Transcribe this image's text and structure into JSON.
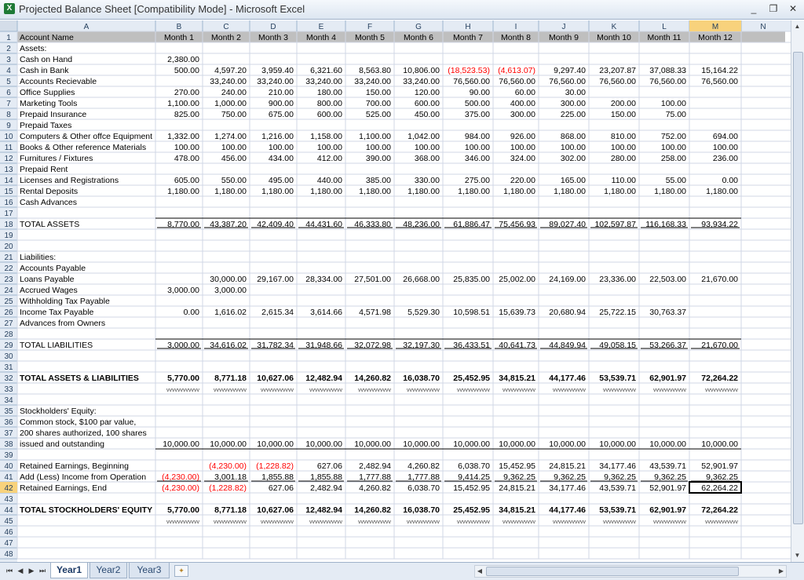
{
  "window": {
    "title": "Projected Balance Sheet  [Compatibility Mode] - Microsoft Excel",
    "icon": "excel-icon",
    "controls": [
      "_",
      "❐",
      "✕"
    ]
  },
  "grid": {
    "columns": [
      "A",
      "B",
      "C",
      "D",
      "E",
      "F",
      "G",
      "H",
      "I",
      "J",
      "K",
      "L",
      "M",
      "N"
    ],
    "selected_column": "M",
    "selected_row": 42,
    "row_count": 48,
    "rows": [
      [
        "Account Name",
        "Month 1",
        "Month 2",
        "Month 3",
        "Month 4",
        "Month 5",
        "Month 6",
        "Month 7",
        "Month 8",
        "Month 9",
        "Month 10",
        "Month 11",
        "Month 12"
      ],
      [
        "Assets:"
      ],
      [
        "Cash on Hand",
        "2,380.00"
      ],
      [
        "Cash in Bank",
        "500.00",
        "4,597.20",
        "3,959.40",
        "6,321.60",
        "8,563.80",
        "10,806.00",
        "(18,523.53)",
        "(4,613.07)",
        "9,297.40",
        "23,207.87",
        "37,088.33",
        "15,164.22"
      ],
      [
        "Accounts Recievable",
        "",
        "33,240.00",
        "33,240.00",
        "33,240.00",
        "33,240.00",
        "33,240.00",
        "76,560.00",
        "76,560.00",
        "76,560.00",
        "76,560.00",
        "76,560.00",
        "76,560.00"
      ],
      [
        "Office Supplies",
        "270.00",
        "240.00",
        "210.00",
        "180.00",
        "150.00",
        "120.00",
        "90.00",
        "60.00",
        "30.00"
      ],
      [
        "Marketing Tools",
        "1,100.00",
        "1,000.00",
        "900.00",
        "800.00",
        "700.00",
        "600.00",
        "500.00",
        "400.00",
        "300.00",
        "200.00",
        "100.00"
      ],
      [
        "Prepaid Insurance",
        "825.00",
        "750.00",
        "675.00",
        "600.00",
        "525.00",
        "450.00",
        "375.00",
        "300.00",
        "225.00",
        "150.00",
        "75.00"
      ],
      [
        "Prepaid Taxes"
      ],
      [
        "Computers & Other offce Equipment",
        "1,332.00",
        "1,274.00",
        "1,216.00",
        "1,158.00",
        "1,100.00",
        "1,042.00",
        "984.00",
        "926.00",
        "868.00",
        "810.00",
        "752.00",
        "694.00"
      ],
      [
        "Books & Other reference Materials",
        "100.00",
        "100.00",
        "100.00",
        "100.00",
        "100.00",
        "100.00",
        "100.00",
        "100.00",
        "100.00",
        "100.00",
        "100.00",
        "100.00"
      ],
      [
        "Furnitures / Fixtures",
        "478.00",
        "456.00",
        "434.00",
        "412.00",
        "390.00",
        "368.00",
        "346.00",
        "324.00",
        "302.00",
        "280.00",
        "258.00",
        "236.00"
      ],
      [
        "Prepaid Rent"
      ],
      [
        "Licenses and Registrations",
        "605.00",
        "550.00",
        "495.00",
        "440.00",
        "385.00",
        "330.00",
        "275.00",
        "220.00",
        "165.00",
        "110.00",
        "55.00",
        "0.00"
      ],
      [
        "Rental Deposits",
        "1,180.00",
        "1,180.00",
        "1,180.00",
        "1,180.00",
        "1,180.00",
        "1,180.00",
        "1,180.00",
        "1,180.00",
        "1,180.00",
        "1,180.00",
        "1,180.00",
        "1,180.00"
      ],
      [
        "Cash Advances"
      ],
      [],
      [
        "TOTAL ASSETS",
        "8,770.00",
        "43,387.20",
        "42,409.40",
        "44,431.60",
        "46,333.80",
        "48,236.00",
        "61,886.47",
        "75,456.93",
        "89,027.40",
        "102,597.87",
        "116,168.33",
        "93,934.22"
      ],
      [],
      [],
      [
        "Liabilities:"
      ],
      [
        "Accounts Payable"
      ],
      [
        "Loans Payable",
        "",
        "30,000.00",
        "29,167.00",
        "28,334.00",
        "27,501.00",
        "26,668.00",
        "25,835.00",
        "25,002.00",
        "24,169.00",
        "23,336.00",
        "22,503.00",
        "21,670.00"
      ],
      [
        "Accrued Wages",
        "3,000.00",
        "3,000.00"
      ],
      [
        "Withholding Tax Payable"
      ],
      [
        "Income Tax Payable",
        "0.00",
        "1,616.02",
        "2,615.34",
        "3,614.66",
        "4,571.98",
        "5,529.30",
        "10,598.51",
        "15,639.73",
        "20,680.94",
        "25,722.15",
        "30,763.37"
      ],
      [
        "Advances from Owners"
      ],
      [],
      [
        "TOTAL LIABILITIES",
        "3,000.00",
        "34,616.02",
        "31,782.34",
        "31,948.66",
        "32,072.98",
        "32,197.30",
        "36,433.51",
        "40,641.73",
        "44,849.94",
        "49,058.15",
        "53,266.37",
        "21,670.00"
      ],
      [],
      [],
      [
        "TOTAL ASSETS & LIABILITIES",
        "5,770.00",
        "8,771.18",
        "10,627.06",
        "12,482.94",
        "14,260.82",
        "16,038.70",
        "25,452.95",
        "34,815.21",
        "44,177.46",
        "53,539.71",
        "62,901.97",
        "72,264.22"
      ],
      [
        "",
        "vvvvvvvvvvvv",
        "vvvvvvvvvvvv",
        "vvvvvvvvvvvv",
        "vvvvvvvvvvvv",
        "vvvvvvvvvvvv",
        "vvvvvvvvvvvv",
        "vvvvvvvvvvvv",
        "vvvvvvvvvvvv",
        "vvvvvvvvvvvv",
        "vvvvvvvvvvvv",
        "vvvvvvvvvvvv",
        "vvvvvvvvvvvv"
      ],
      [],
      [
        "Stockholders' Equity:"
      ],
      [
        "Common stock, $100 par value,"
      ],
      [
        "   200 shares authorized, 100 shares"
      ],
      [
        "   issued and outstanding",
        "10,000.00",
        "10,000.00",
        "10,000.00",
        "10,000.00",
        "10,000.00",
        "10,000.00",
        "10,000.00",
        "10,000.00",
        "10,000.00",
        "10,000.00",
        "10,000.00",
        "10,000.00"
      ],
      [],
      [
        "Retained Earnings, Beginning",
        "",
        "(4,230.00)",
        "(1,228.82)",
        "627.06",
        "2,482.94",
        "4,260.82",
        "6,038.70",
        "15,452.95",
        "24,815.21",
        "34,177.46",
        "43,539.71",
        "52,901.97"
      ],
      [
        "Add (Less) Income from Operation",
        "(4,230.00)",
        "3,001.18",
        "1,855.88",
        "1,855.88",
        "1,777.88",
        "1,777.88",
        "9,414.25",
        "9,362.25",
        "9,362.25",
        "9,362.25",
        "9,362.25",
        "9,362.25"
      ],
      [
        "Retained Earnings, End",
        "(4,230.00)",
        "(1,228.82)",
        "627.06",
        "2,482.94",
        "4,260.82",
        "6,038.70",
        "15,452.95",
        "24,815.21",
        "34,177.46",
        "43,539.71",
        "52,901.97",
        "62,264.22"
      ],
      [],
      [
        "TOTAL STOCKHOLDERS' EQUITY",
        "5,770.00",
        "8,771.18",
        "10,627.06",
        "12,482.94",
        "14,260.82",
        "16,038.70",
        "25,452.95",
        "34,815.21",
        "44,177.46",
        "53,539.71",
        "62,901.97",
        "72,264.22"
      ],
      [
        "",
        "vvvvvvvvvvvv",
        "vvvvvvvvvvvv",
        "vvvvvvvvvvvv",
        "vvvvvvvvvvvv",
        "vvvvvvvvvvvv",
        "vvvvvvvvvvvv",
        "vvvvvvvvvvvv",
        "vvvvvvvvvvvv",
        "vvvvvvvvvvvv",
        "vvvvvvvvvvvv",
        "vvvvvvvvvvvv",
        "vvvvvvvvvvvv"
      ],
      [],
      [],
      []
    ]
  },
  "sheet_tabs": {
    "tabs": [
      "Year1",
      "Year2",
      "Year3"
    ],
    "active": "Year1",
    "nav_buttons": [
      "⏮",
      "◀",
      "▶",
      "⏭"
    ]
  },
  "colors": {
    "negative": "#ff0000",
    "header_bg": "#e4ebf4",
    "header_selected_bg": "#f8d27c",
    "gridline": "#d0d7e5",
    "row1_bg": "#bfbfbf"
  }
}
